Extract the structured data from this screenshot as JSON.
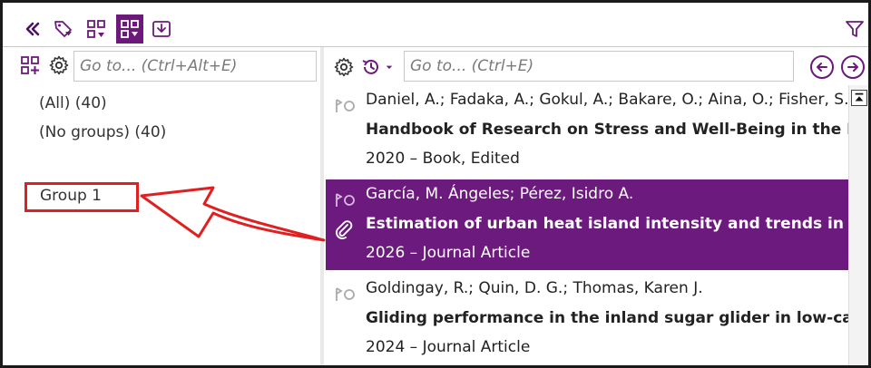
{
  "colors": {
    "accent": "#6b1a7a",
    "selection": "#6c1a7d",
    "annotation": "#e02020"
  },
  "toolbar": {
    "icons": [
      "collapse-double-chevron-icon",
      "tag-filter-icon",
      "group-tree-icon",
      "group-grid-icon",
      "import-icon",
      "filter-funnel-icon"
    ]
  },
  "left_pane": {
    "goto_placeholder": "Go to... (Ctrl+Alt+E)",
    "groups": {
      "all": "(All) (40)",
      "no_groups": "(No groups) (40)",
      "group1": "Group 1"
    }
  },
  "right_pane": {
    "goto_placeholder": "Go to... (Ctrl+E)",
    "references": [
      {
        "authors": "Daniel, A.; Fadaka, A.; Gokul, A.; Bakare, O.; Aina, O.; Fisher, S.",
        "title": "Handbook of Research on Stress and Well-Being in the Publi",
        "meta": "2020 – Book, Edited",
        "selected": false,
        "has_attachment": false
      },
      {
        "authors": "García, M. Ángeles; Pérez, Isidro A.",
        "title": "Estimation of urban heat island intensity and trends in Spani",
        "meta": "2026 – Journal Article",
        "selected": true,
        "has_attachment": true
      },
      {
        "authors": "Goldingay, R.; Quin, D. G.; Thomas, Karen J.",
        "title": "Gliding performance in the inland sugar glider in low-canop",
        "meta": "2024 – Journal Article",
        "selected": false,
        "has_attachment": false
      }
    ]
  }
}
